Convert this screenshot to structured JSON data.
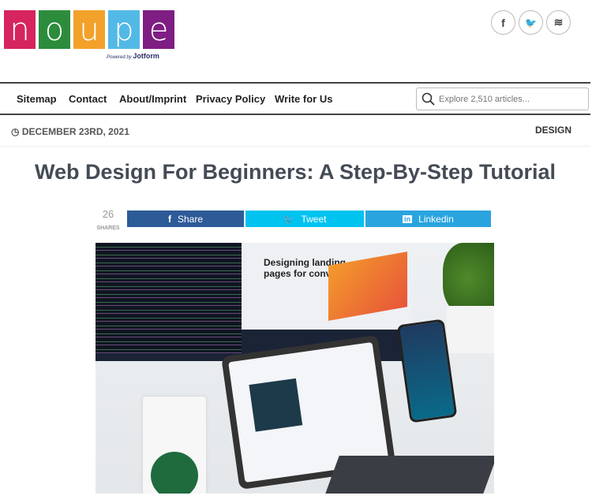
{
  "logo": {
    "letters": [
      "n",
      "o",
      "u",
      "p",
      "e"
    ],
    "colors": [
      "#d6245f",
      "#2c8c3c",
      "#f2a22a",
      "#52b9e6",
      "#7e1d82"
    ],
    "powered_by": "Powered by",
    "brand": "Jotform"
  },
  "social": [
    {
      "icon": "facebook-icon",
      "glyph": "f"
    },
    {
      "icon": "twitter-icon",
      "glyph": "🐦"
    },
    {
      "icon": "rss-icon",
      "glyph": "≋"
    }
  ],
  "nav": {
    "items": [
      "Sitemap",
      "Contact",
      "About/Imprint",
      "Privacy Policy",
      "Write for Us"
    ],
    "search_placeholder": "Explore 2,510 articles..."
  },
  "article": {
    "date": "DECEMBER 23RD, 2021",
    "category": "DESIGN",
    "title": "Web Design For Beginners: A Step-By-Step Tutorial",
    "share_count": "26",
    "shares_label": "SHARES",
    "share_buttons": [
      {
        "label": "Share",
        "icon": "f",
        "color": "#2d5b98"
      },
      {
        "label": "Tweet",
        "icon": "🐦",
        "color": "#00c3ef"
      },
      {
        "label": "Linkedin",
        "icon": "in",
        "color": "#2aa4df"
      }
    ],
    "hero_text": [
      "Designing landing",
      "pages for conversion"
    ]
  }
}
